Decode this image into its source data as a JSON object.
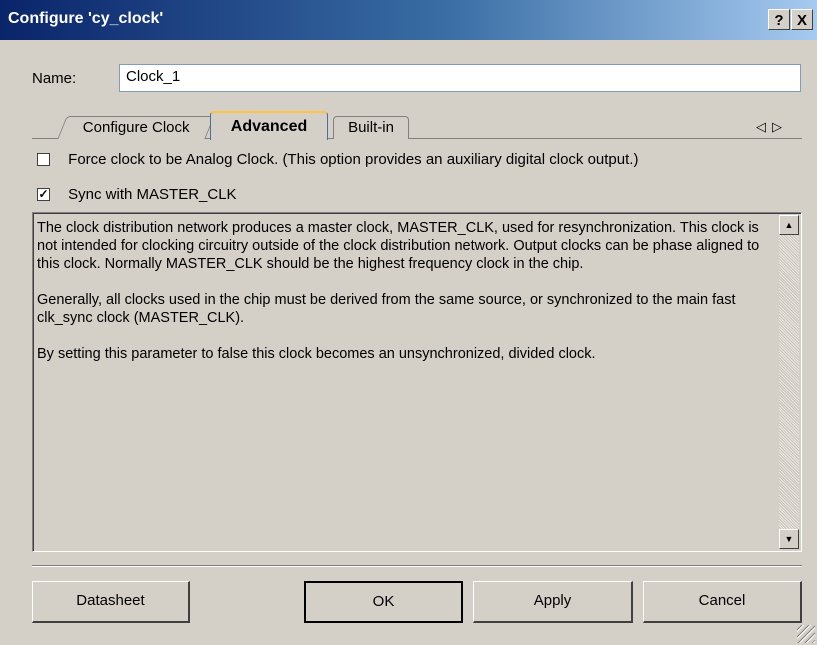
{
  "window": {
    "title": "Configure 'cy_clock'",
    "help_label": "?",
    "close_label": "X"
  },
  "name_field": {
    "label": "Name:",
    "value": "Clock_1"
  },
  "tabs": [
    {
      "label": "Configure Clock",
      "active": false
    },
    {
      "label": "Advanced",
      "active": true
    },
    {
      "label": "Built-in",
      "active": false
    }
  ],
  "tab_scroll": {
    "left": "◁",
    "right": "▷"
  },
  "options": [
    {
      "label": "Force clock to be Analog Clock. (This option provides an auxiliary digital clock output.)",
      "checked": false
    },
    {
      "label": "Sync with MASTER_CLK",
      "checked": true
    }
  ],
  "description": {
    "paragraphs": [
      "The clock distribution network produces a master clock, MASTER_CLK, used for resynchronization. This clock is not intended for clocking circuitry outside of the clock distribution network. Output clocks can be phase aligned to this clock. Normally MASTER_CLK should be the highest frequency clock in the chip.",
      "Generally, all clocks used in the chip must be derived from the same source, or synchronized to the main fast clk_sync clock (MASTER_CLK).",
      "By setting this parameter to false this clock becomes an unsynchronized, divided clock."
    ]
  },
  "buttons": {
    "datasheet": "Datasheet",
    "ok": "OK",
    "apply": "Apply",
    "cancel": "Cancel"
  }
}
